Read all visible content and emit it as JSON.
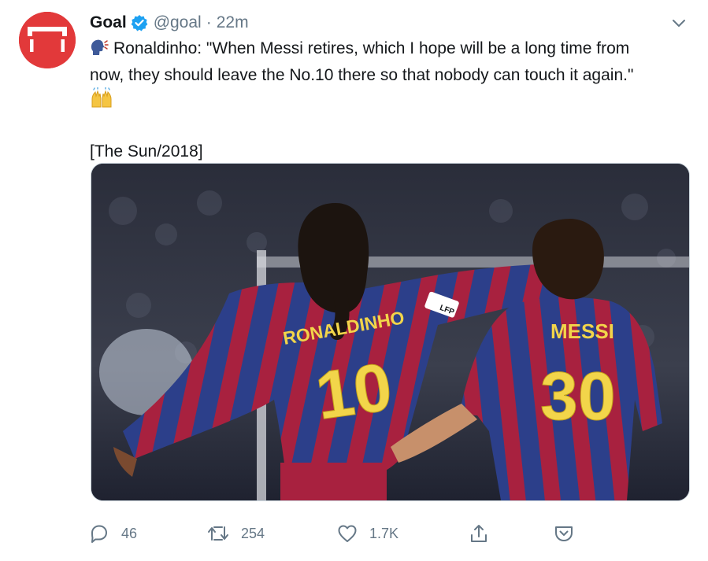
{
  "account": {
    "name": "Goal",
    "handle": "@goal",
    "separator": "·",
    "time": "22m"
  },
  "tweet": {
    "line1": "Ronaldinho: \"When Messi retires, which I hope will be a long time from",
    "line2": "now, they should leave the No.10 there so that nobody can touch it again.\"",
    "source": "[The Sun/2018]"
  },
  "media": {
    "jersey_left_name": "RONALDINHO",
    "jersey_left_number": "10",
    "jersey_right_name": "MESSI",
    "jersey_right_number": "30",
    "sleeve_badge": "LFP"
  },
  "actions": {
    "replies": "46",
    "retweets": "254",
    "likes": "1.7K"
  },
  "colors": {
    "brand": "#e2393a",
    "verified": "#1da1f2",
    "muted": "#657786",
    "text": "#14171a"
  },
  "icons": {
    "avatar": "goal-logo-icon",
    "verified": "verified-badge-icon",
    "caret": "chevron-down-icon",
    "speaking": "speaking-head-emoji",
    "hands": "raising-hands-emoji",
    "reply": "reply-icon",
    "retweet": "retweet-icon",
    "like": "heart-icon",
    "share": "share-icon",
    "pocket": "pocket-icon"
  }
}
